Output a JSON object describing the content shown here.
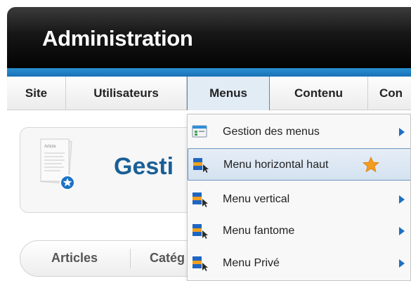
{
  "header": {
    "title": "Administration"
  },
  "nav": {
    "items": [
      {
        "label": "Site"
      },
      {
        "label": "Utilisateurs"
      },
      {
        "label": "Menus"
      },
      {
        "label": "Contenu"
      },
      {
        "label": "Con"
      }
    ]
  },
  "page": {
    "title": "Gesti",
    "article_icon_text": "Article",
    "tabs": [
      {
        "label": "Articles"
      },
      {
        "label": "Catég"
      }
    ]
  },
  "dropdown": {
    "items": [
      {
        "label": "Gestion des menus",
        "icon": "menu-manager-icon",
        "has_submenu": true
      },
      {
        "label": "Menu horizontal haut",
        "icon": "menu-icon",
        "highlighted": true,
        "default_star": true
      },
      {
        "label": "Menu vertical",
        "icon": "menu-icon",
        "has_submenu": true
      },
      {
        "label": "Menu fantome",
        "icon": "menu-icon",
        "has_submenu": true
      },
      {
        "label": "Menu Privé",
        "icon": "menu-icon",
        "has_submenu": true
      }
    ]
  },
  "colors": {
    "accent_blue": "#1771b7",
    "title_blue": "#1a5f96",
    "star_orange": "#f39c1f",
    "submenu_arrow": "#1d6fc2"
  }
}
